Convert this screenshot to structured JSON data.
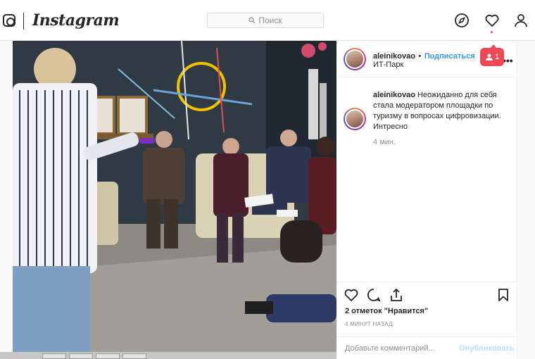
{
  "header": {
    "brand": "Instagram",
    "search_placeholder": "Поиск"
  },
  "post": {
    "username": "aleinikovao",
    "separator": "•",
    "follow_label": "Подписаться",
    "location": "ИТ-Парк",
    "caption": "Неожиданно для себя стала модератором площадки по туризму в вопросах цифровизации. Интресно",
    "caption_time": "4 мин.",
    "likes_count": "2 отметок",
    "likes_label": "\"Нравится\"",
    "posted_time": "4 МИНУТ НАЗАД",
    "comment_placeholder": "Добавьте комментарий...",
    "publish_label": "Опубликовать"
  },
  "notification": {
    "count": "1"
  },
  "colors": {
    "accent": "#3897f0",
    "notify": "#ed4956",
    "border": "#dbdbdb"
  },
  "icons": [
    "instagram-logo-icon",
    "search-icon",
    "explore-compass-icon",
    "activity-heart-icon",
    "profile-icon",
    "more-options-icon",
    "like-heart-icon",
    "comment-icon",
    "share-icon",
    "bookmark-icon",
    "person-icon"
  ]
}
